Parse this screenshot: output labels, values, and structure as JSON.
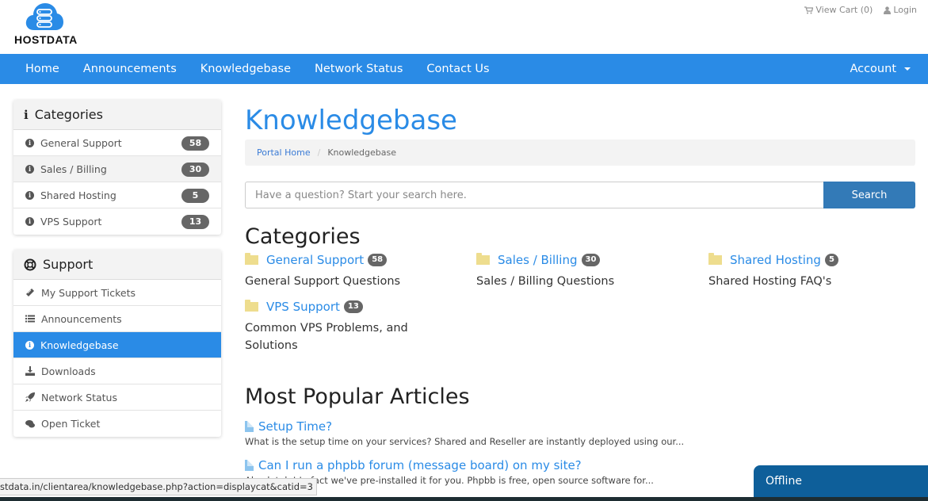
{
  "brand": {
    "name": "HOSTDATA",
    "logo_icon": "cloud-server-icon"
  },
  "top_links": {
    "cart": {
      "icon": "cart-icon",
      "label": "View Cart (0)"
    },
    "login": {
      "icon": "user-icon",
      "label": "Login"
    }
  },
  "nav": {
    "items": [
      "Home",
      "Announcements",
      "Knowledgebase",
      "Network Status",
      "Contact Us"
    ],
    "account": "Account"
  },
  "sidebar": {
    "categories": {
      "title": "Categories",
      "icon": "info-icon",
      "items": [
        {
          "label": "General Support",
          "count": "58"
        },
        {
          "label": "Sales / Billing",
          "count": "30"
        },
        {
          "label": "Shared Hosting",
          "count": "5"
        },
        {
          "label": "VPS Support",
          "count": "13"
        }
      ]
    },
    "support": {
      "title": "Support",
      "icon": "life-ring-icon",
      "items": [
        {
          "label": "My Support Tickets",
          "icon": "ticket-icon"
        },
        {
          "label": "Announcements",
          "icon": "list-icon"
        },
        {
          "label": "Knowledgebase",
          "icon": "info-icon",
          "active": true
        },
        {
          "label": "Downloads",
          "icon": "download-icon"
        },
        {
          "label": "Network Status",
          "icon": "rocket-icon"
        },
        {
          "label": "Open Ticket",
          "icon": "comments-icon"
        }
      ]
    }
  },
  "main": {
    "title": "Knowledgebase",
    "breadcrumb": {
      "home": "Portal Home",
      "separator": "/",
      "current": "Knowledgebase"
    },
    "search": {
      "placeholder": "Have a question? Start your search here.",
      "value": "",
      "button": "Search"
    },
    "categories_title": "Categories",
    "categories": [
      {
        "name": "General Support",
        "count": "58",
        "description": "General Support Questions"
      },
      {
        "name": "Sales / Billing",
        "count": "30",
        "description": "Sales / Billing Questions"
      },
      {
        "name": "Shared Hosting",
        "count": "5",
        "description": "Shared Hosting FAQ's"
      },
      {
        "name": "VPS Support",
        "count": "13",
        "description": "Common VPS Problems, and Solutions"
      }
    ],
    "popular_title": "Most Popular Articles",
    "articles": [
      {
        "title": "Setup Time?",
        "excerpt": "What is the setup time on your services? Shared and Reseller are instantly deployed using our..."
      },
      {
        "title": "Can I run a phpbb forum (message board) on my site?",
        "excerpt": "Absolutely! In fact we've pre-installed it for you. Phpbb is free, open source software for..."
      }
    ]
  },
  "status_bar_url": "stdata.in/clientarea/knowledgebase.php?action=displaycat&catid=3",
  "chat_widget": {
    "label": "Offline"
  },
  "colors": {
    "primary": "#2a8be6",
    "search_button": "#337ab7",
    "chat": "#0e5f9a",
    "badge": "#666666",
    "folder": "#eedd8e"
  }
}
